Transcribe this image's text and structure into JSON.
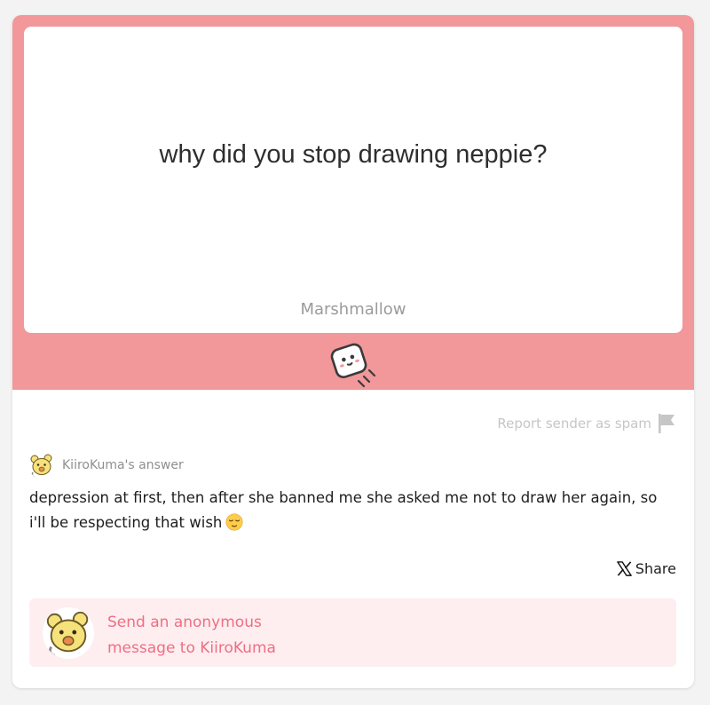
{
  "question": {
    "text": "why did you stop drawing neppie?",
    "brand": "Marshmallow"
  },
  "spam": {
    "label": "Report sender as spam",
    "icon": "flag-icon"
  },
  "answer": {
    "author_label": "KiiroKuma's answer",
    "text": "depression at first, then after she banned me she asked me not to draw her again, so i'll be respecting that wish",
    "emoji": "relieved-face-emoji"
  },
  "share": {
    "label": "Share",
    "icon": "x-logo-icon"
  },
  "send": {
    "line1": "Send an anonymous",
    "line2": "message to KiiroKuma"
  },
  "colors": {
    "frame": "#f2979a",
    "accent": "#ef6e83",
    "send_bg": "#feeef0",
    "muted": "#c6c6c6"
  }
}
